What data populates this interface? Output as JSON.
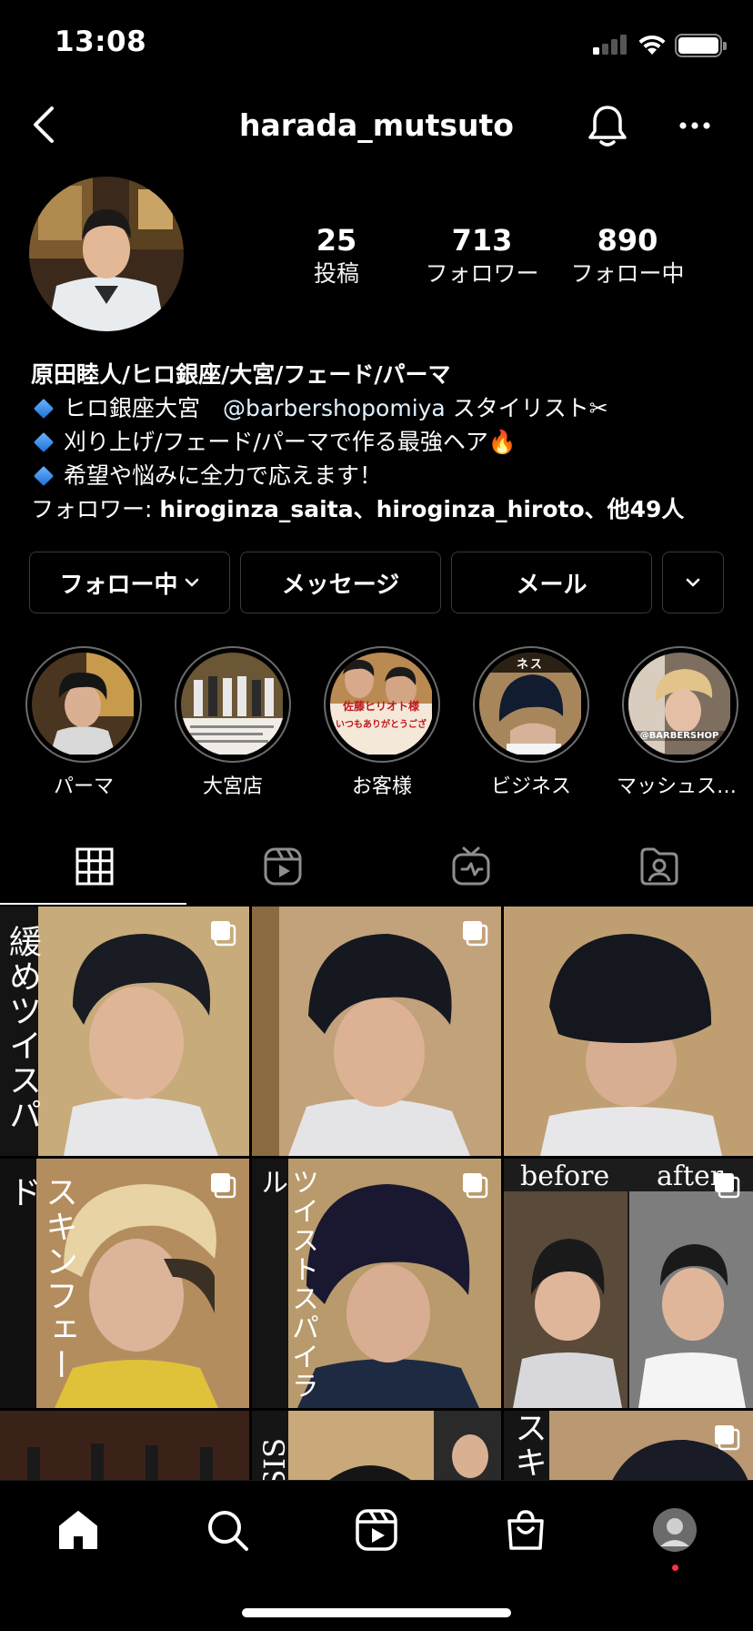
{
  "status_bar": {
    "time": "13:08"
  },
  "header": {
    "username": "harada_mutsuto"
  },
  "profile": {
    "stats": [
      {
        "value": "25",
        "label": "投稿"
      },
      {
        "value": "713",
        "label": "フォロワー"
      },
      {
        "value": "890",
        "label": "フォロー中"
      }
    ],
    "bio": {
      "name": "原田睦人/ヒロ銀座/大宮/フェード/パーマ",
      "line1_pre": "ヒロ銀座大宮　",
      "line1_mention": "@barbershopomiya",
      "line1_post": " スタイリスト✂",
      "line2": "刈り上げ/フェード/パーマで作る最強ヘア🔥",
      "line3": "希望や悩みに全力で応えます！",
      "followers_prefix": "フォロワー: ",
      "followers_names": "hiroginza_saita、hiroginza_hiroto、他49人"
    }
  },
  "actions": {
    "following": "フォロー中",
    "message": "メッセージ",
    "email": "メール"
  },
  "highlights": [
    {
      "label": "パーマ"
    },
    {
      "label": "大宮店"
    },
    {
      "label": "お客様"
    },
    {
      "label": "ビジネス"
    },
    {
      "label": "マッシュスタ…"
    }
  ],
  "highlight_texts": {
    "customer_banner": "佐藤ヒリオト様",
    "customer_thanks": "いつもありがとうござ",
    "business_banner": "ネス",
    "mash_tag": "@BARBERSHOP"
  },
  "grid_texts": {
    "post1": "緩めツイスパ",
    "post4": "スキンフェード",
    "post5": "ツイストスパイラル",
    "post6_before": "before",
    "post6_after": "after",
    "post8": "SIS",
    "post9": "スキ"
  },
  "colors": {
    "background": "#000000",
    "text": "#ffffff",
    "button_border": "#3a3a3a",
    "notification_dot": "#ff3040"
  }
}
